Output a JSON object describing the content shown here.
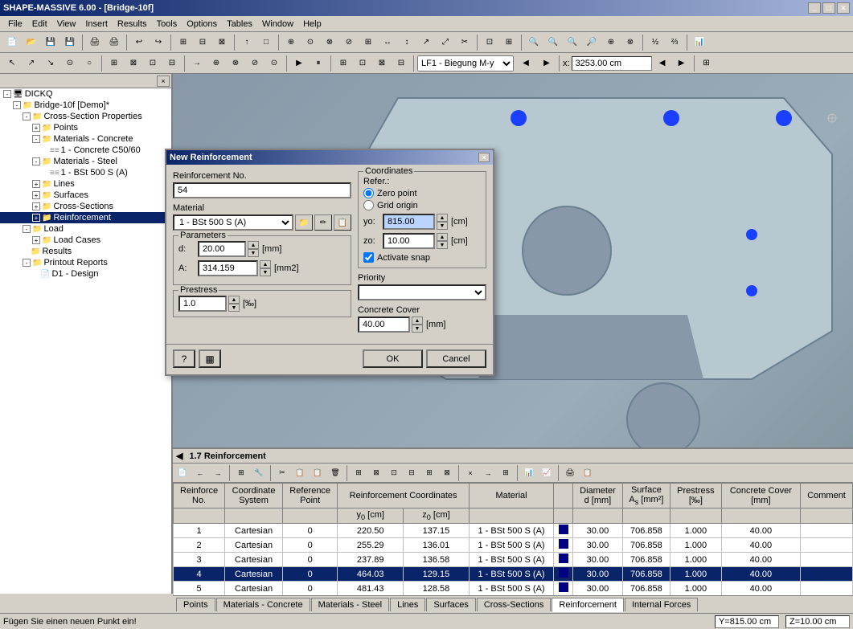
{
  "app": {
    "title": "SHAPE-MASSIVE 6.00 - [Bridge-10f]",
    "window_buttons": [
      "_",
      "□",
      "×"
    ]
  },
  "menu": {
    "items": [
      "File",
      "Edit",
      "View",
      "Insert",
      "Results",
      "Tools",
      "Options",
      "Tables",
      "Window",
      "Help"
    ]
  },
  "tree": {
    "root": "DICKQ",
    "project": "Bridge-10f [Demo]*",
    "items": [
      {
        "label": "Cross-Section Properties",
        "indent": 1,
        "expanded": true
      },
      {
        "label": "Points",
        "indent": 2
      },
      {
        "label": "Materials - Concrete",
        "indent": 2,
        "expanded": true
      },
      {
        "label": "1 - Concrete C50/60",
        "indent": 3,
        "icon": "material"
      },
      {
        "label": "Materials - Steel",
        "indent": 2,
        "expanded": true
      },
      {
        "label": "1 - BSt 500 S (A)",
        "indent": 3,
        "icon": "material"
      },
      {
        "label": "Lines",
        "indent": 2
      },
      {
        "label": "Surfaces",
        "indent": 2
      },
      {
        "label": "Cross-Sections",
        "indent": 2
      },
      {
        "label": "Reinforcement",
        "indent": 2,
        "selected": true
      },
      {
        "label": "Load",
        "indent": 1,
        "expanded": true
      },
      {
        "label": "Load Cases",
        "indent": 2
      },
      {
        "label": "Results",
        "indent": 1
      },
      {
        "label": "Printout Reports",
        "indent": 1,
        "expanded": true
      },
      {
        "label": "D1 - Design",
        "indent": 2
      }
    ]
  },
  "dialog": {
    "title": "New Reinforcement",
    "close_button": "×",
    "reinforcement_no_label": "Reinforcement No.",
    "reinforcement_no_value": "54",
    "material_label": "Material",
    "material_value": "1 - BSt 500 S (A)",
    "parameters_label": "Parameters",
    "d_label": "d:",
    "d_value": "20.00",
    "d_unit": "[mm]",
    "a_label": "A:",
    "a_value": "314.159",
    "a_unit": "[mm2]",
    "prestress_label": "Prestress",
    "prestress_value": "1.0",
    "prestress_unit": "[‰]",
    "coordinates_label": "Coordinates",
    "refer_label": "Refer.:",
    "zero_point_label": "Zero point",
    "grid_origin_label": "Grid origin",
    "yo_label": "yo:",
    "yo_value": "815.00",
    "yo_unit": "[cm]",
    "zo_label": "zo:",
    "zo_value": "10.00",
    "zo_unit": "[cm]",
    "activate_snap_label": "Activate snap",
    "priority_label": "Priority",
    "concrete_cover_label": "Concrete Cover",
    "concrete_cover_value": "40.00",
    "concrete_cover_unit": "[mm]",
    "ok_label": "OK",
    "cancel_label": "Cancel"
  },
  "reinf_panel": {
    "title": "1.7 Reinforcement",
    "columns": [
      "Reinforce\nNo.",
      "Coordinate\nSystem",
      "Reference\nPoint",
      "Reinforcement Coordinates\ny0 [cm]",
      "z0 [cm]",
      "Material",
      "",
      "Diameter\nd [mm]",
      "Surface\nAs [mm²]",
      "Prestress\n[‰]",
      "Concrete Cover\n[mm]",
      "Comment"
    ],
    "col_headers": [
      "Reinforce\nNo.",
      "Coordinate\nSystem",
      "Reference\nPoint",
      "y0 [cm]",
      "z0 [cm]",
      "Material",
      "",
      "Diameter d [mm]",
      "Surface As [mm²]",
      "Prestress [‰]",
      "Concrete Cover [mm]",
      "Comment"
    ],
    "rows": [
      {
        "no": "1",
        "sys": "Cartesian",
        "ref": "0",
        "y0": "220.50",
        "z0": "137.15",
        "mat": "1 - BSt 500 S (A)",
        "d": "30.00",
        "a": "706.858",
        "pre": "1.000",
        "cc": "40.00"
      },
      {
        "no": "2",
        "sys": "Cartesian",
        "ref": "0",
        "y0": "255.29",
        "z0": "136.01",
        "mat": "1 - BSt 500 S (A)",
        "d": "30.00",
        "a": "706.858",
        "pre": "1.000",
        "cc": "40.00"
      },
      {
        "no": "3",
        "sys": "Cartesian",
        "ref": "0",
        "y0": "237.89",
        "z0": "136.58",
        "mat": "1 - BSt 500 S (A)",
        "d": "30.00",
        "a": "706.858",
        "pre": "1.000",
        "cc": "40.00"
      },
      {
        "no": "4",
        "sys": "Cartesian",
        "ref": "0",
        "y0": "464.03",
        "z0": "129.15",
        "mat": "1 - BSt 500 S (A)",
        "d": "30.00",
        "a": "706.858",
        "pre": "1.000",
        "cc": "40.00",
        "selected": true
      },
      {
        "no": "5",
        "sys": "Cartesian",
        "ref": "0",
        "y0": "481.43",
        "z0": "128.58",
        "mat": "1 - BSt 500 S (A)",
        "d": "30.00",
        "a": "706.858",
        "pre": "1.000",
        "cc": "40.00"
      }
    ]
  },
  "tabs": {
    "items": [
      "Points",
      "Materials - Concrete",
      "Materials - Steel",
      "Lines",
      "Surfaces",
      "Cross-Sections",
      "Reinforcement",
      "Internal Forces"
    ],
    "active": "Reinforcement"
  },
  "status": {
    "left": "Fügen Sie einen neuen Punkt ein!",
    "y": "Y=815.00 cm",
    "z": "Z=10.00 cm"
  },
  "toolbar1": {
    "buttons": [
      "📄",
      "📂",
      "💾",
      "🖨",
      "🔍",
      "↩",
      "↪",
      "✂",
      "📋",
      "🗑",
      "🔲",
      "📐",
      "📏",
      "⚙",
      "🔧"
    ]
  }
}
